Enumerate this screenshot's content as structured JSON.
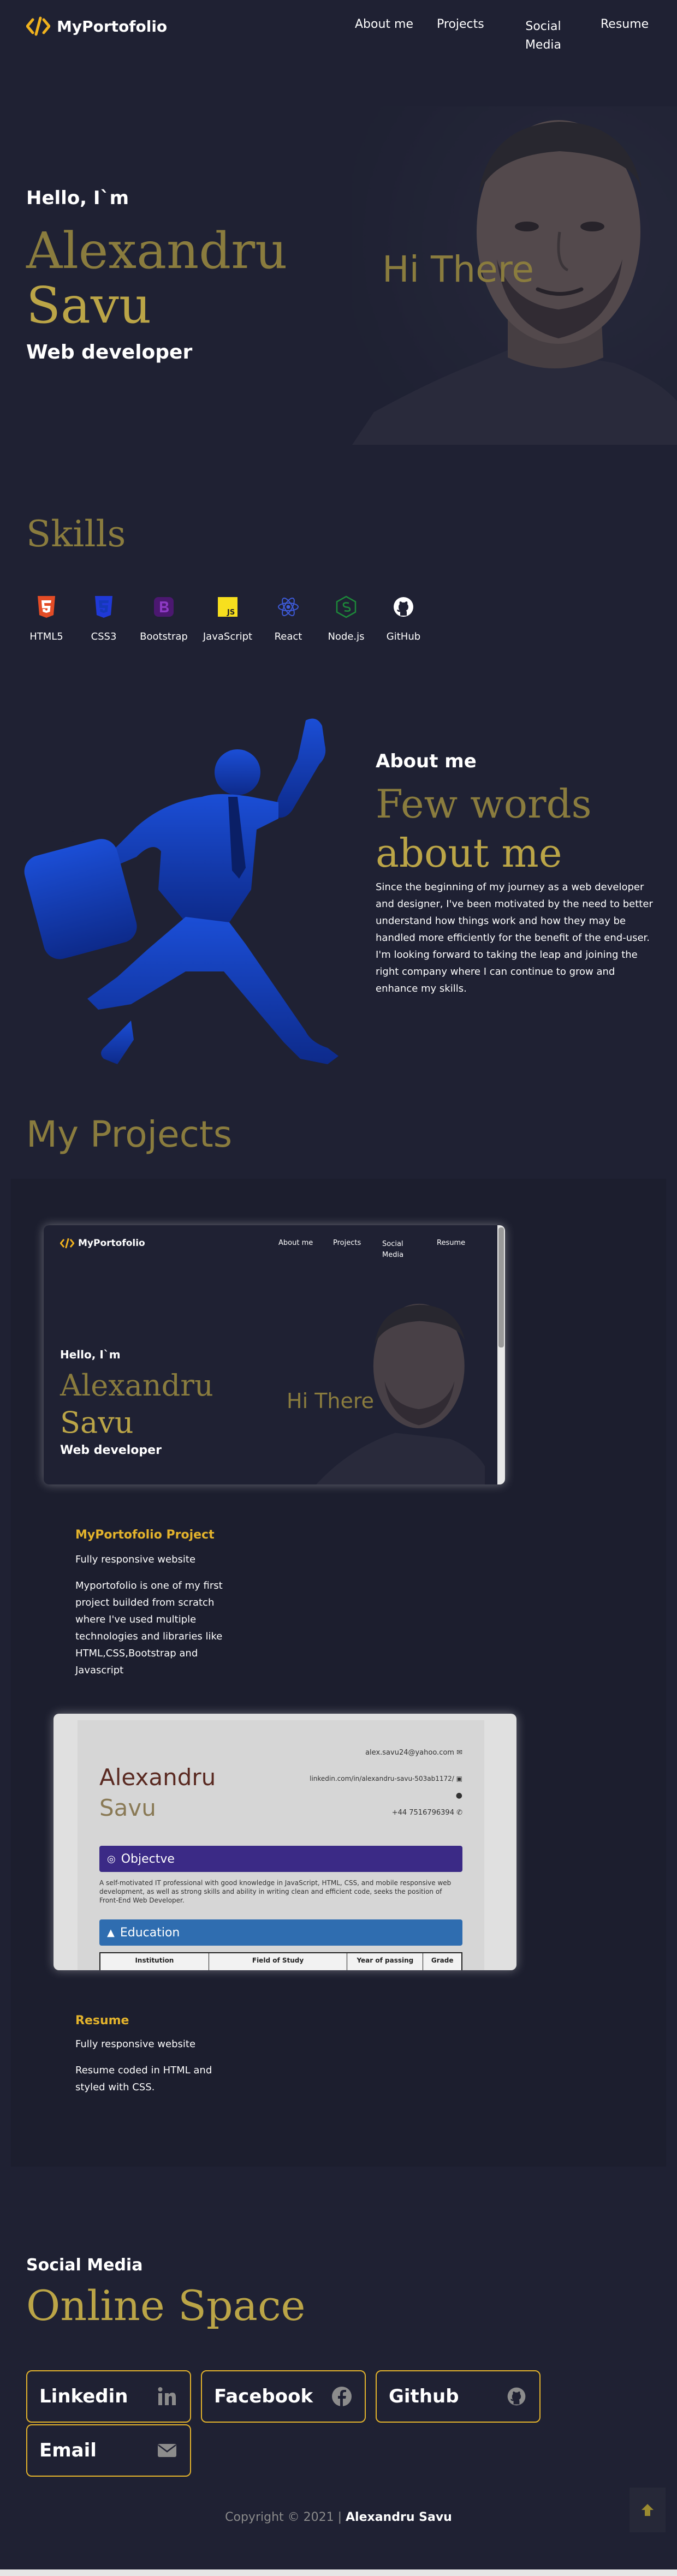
{
  "nav": {
    "brand": "MyPortofolio",
    "links": [
      "About me",
      "Projects",
      "Social",
      "Media",
      "Resume"
    ]
  },
  "hero": {
    "hello": "Hello, I`m",
    "first_name": "Alexandru",
    "last_name": "Savu",
    "role": "Web developer",
    "overlay": "Hi There"
  },
  "skills": {
    "title": "Skills",
    "items": [
      {
        "label": "HTML5",
        "icon": "html5-icon"
      },
      {
        "label": "CSS3",
        "icon": "css3-icon"
      },
      {
        "label": "Bootstrap",
        "icon": "bootstrap-icon"
      },
      {
        "label": "JavaScript",
        "icon": "javascript-icon"
      },
      {
        "label": "React",
        "icon": "react-icon"
      },
      {
        "label": "Node.js",
        "icon": "nodejs-icon"
      },
      {
        "label": "GitHub",
        "icon": "github-icon"
      }
    ]
  },
  "about": {
    "kicker": "About me",
    "title_1": "Few words",
    "title_2": "about me",
    "text": "Since the beginning of my journey as a web developer and designer, I've been motivated by the need to better understand how things work and how they may be handled more efficiently for the benefit of the end-user. I'm looking forward to taking the leap and joining the right company where I can continue to grow and enhance my skills."
  },
  "projects": {
    "title": "My Projects",
    "preview1": {
      "brand": "MyPortofolio",
      "links": [
        "About me",
        "Projects",
        "Social",
        "Media",
        "Resume"
      ],
      "hello": "Hello, I`m",
      "first_name": "Alexandru",
      "last_name": "Savu",
      "role": "Web developer",
      "overlay": "Hi There"
    },
    "project1": {
      "title": "MyPortofolio Project",
      "subtitle": "Fully responsive website",
      "desc": "Myportofolio is one of my first project builded from scratch where I've used multiple technologies and libraries like HTML,CSS,Bootstrap and Javascript"
    },
    "preview2": {
      "email": "alex.savu24@yahoo.com",
      "linkedin": "linkedin.com/in/alexandru-savu-503ab1172/",
      "phone": "+44 7516796394",
      "first_name": "Alexandru",
      "last_name": "Savu",
      "objective_heading": "Objectve",
      "objective_text": "A self-motivated IT professional with good knowledge in JavaScript, HTML, CSS, and mobile responsive web development, as well as strong skills and ability in writing clean and efficient code, seeks the position of Front-End Web Developer.",
      "education_heading": "Education",
      "table_headers": [
        "Institution",
        "Field of Study",
        "Year of passing",
        "Grade"
      ]
    },
    "project2": {
      "title": "Resume",
      "subtitle": "Fully responsive website",
      "desc": "Resume coded in HTML and styled with CSS."
    }
  },
  "social": {
    "kicker": "Social Media",
    "title": "Online Space",
    "buttons": [
      {
        "label": "Linkedin",
        "icon": "linkedin-icon"
      },
      {
        "label": "Facebook",
        "icon": "facebook-icon"
      },
      {
        "label": "Github",
        "icon": "github-icon"
      },
      {
        "label": "Email",
        "icon": "envelope-icon"
      }
    ]
  },
  "footer": {
    "copyright": "Copyright © 2021 |",
    "name": "Alexandru Savu"
  },
  "colors": {
    "background": "#1f2133",
    "gold": "#bba547",
    "gold_dim": "#8a7c3e",
    "accent_yellow": "#e3b32c",
    "about_blue": "#1b49c7"
  }
}
